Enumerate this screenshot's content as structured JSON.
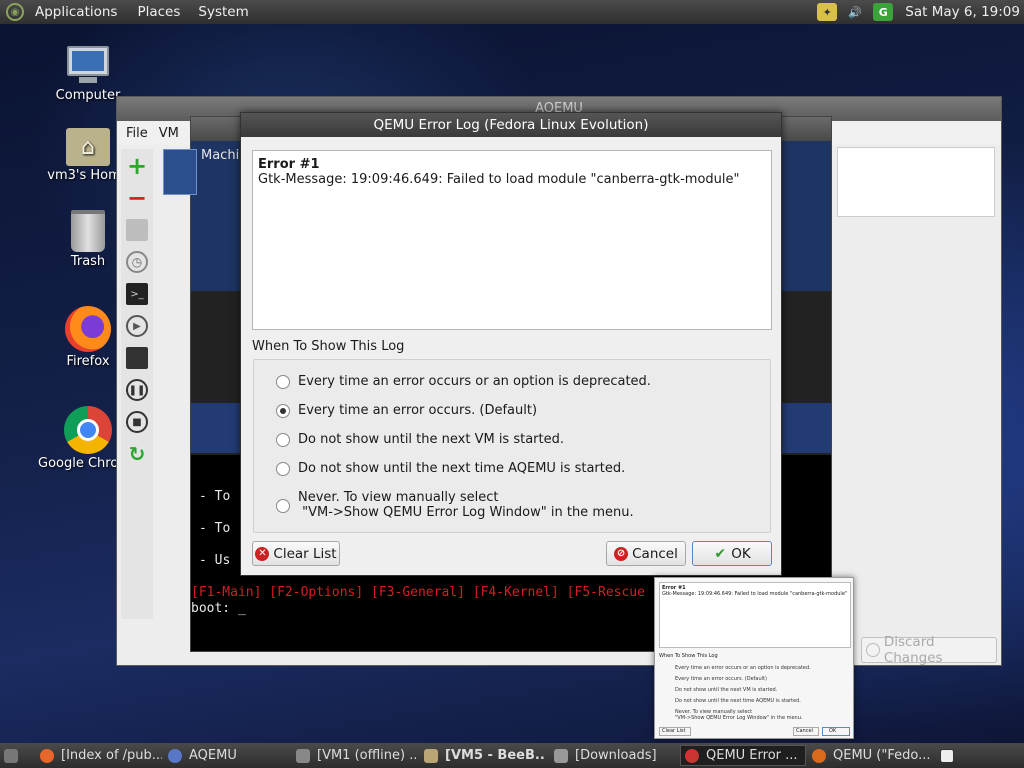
{
  "top_panel": {
    "menus": [
      "Applications",
      "Places",
      "System"
    ],
    "clock": "Sat May  6, 19:09"
  },
  "desktop_icons": [
    {
      "label": "Computer",
      "icon": "computer-icon"
    },
    {
      "label": "vm3's Home",
      "icon": "home-folder-icon"
    },
    {
      "label": "Trash",
      "icon": "trash-icon"
    },
    {
      "label": "Firefox",
      "icon": "firefox-icon"
    },
    {
      "label": "Google Chrome",
      "icon": "chrome-icon"
    }
  ],
  "aqemu_window": {
    "title": "AQEMU",
    "menu": [
      "File",
      "VM"
    ],
    "discard_label": "Discard Changes"
  },
  "vm_window": {
    "machine_label": "Machi",
    "console_lines": [
      "-  To",
      "-  To",
      "-  Us"
    ],
    "fkeys": "[F1-Main] [F2-Options] [F3-General] [F4-Kernel] [F5-Rescue",
    "boot_prompt": "boot: _"
  },
  "dialog": {
    "title": "QEMU Error Log (Fedora Linux Evolution)",
    "log_heading": "Error #1",
    "log_text": "Gtk-Message: 19:09:46.649: Failed to load module \"canberra-gtk-module\"",
    "group_label": "When To Show This Log",
    "options": [
      {
        "label": "Every time an error occurs or an option is deprecated.",
        "selected": false
      },
      {
        "label": "Every time an error occurs. (Default)",
        "selected": true
      },
      {
        "label": "Do not show until the next VM is started.",
        "selected": false
      },
      {
        "label": "Do not show until the next time AQEMU is started.",
        "selected": false
      },
      {
        "label": "Never. To view manually select",
        "label2": " \"VM->Show QEMU Error Log Window\" in the menu.",
        "selected": false
      }
    ],
    "clear_label": "Clear List",
    "cancel_label": "Cancel",
    "ok_label": "OK"
  },
  "thumbnail": {
    "heading": "Error #1",
    "text": "Gtk-Message: 19:09:46.649: Failed to load module \"canberra-gtk-module\"",
    "group": "When To Show This Log",
    "lines": [
      "Every time an error occurs or an option is deprecated.",
      "Every time an error occurs. (Default)",
      "Do not show until the next VM is started.",
      "Do not show until the next time AQEMU is started.",
      "Never. To view manually select",
      "\"VM->Show QEMU Error Log Window\" in the menu."
    ],
    "clear": "Clear List",
    "cancel": "Cancel",
    "ok": "OK"
  },
  "taskbar": {
    "items": [
      {
        "label": "[Index of /pub...",
        "icon": "firefox-icon"
      },
      {
        "label": "AQEMU",
        "icon": "aqemu-icon"
      },
      {
        "label": "[VM1 (offline) ...",
        "icon": "vm-icon"
      },
      {
        "label": "[VM5 - BeeB...",
        "icon": "folder-icon"
      },
      {
        "label": "[Downloads]",
        "icon": "folder-icon"
      },
      {
        "label": "QEMU Error ...",
        "icon": "qemu-icon"
      },
      {
        "label": "QEMU (\"Fedo...",
        "icon": "qemu-icon"
      }
    ]
  },
  "colors": {
    "desktop": "#132048",
    "panel": "#3a3a3a",
    "console_red": "#d22020",
    "ok_accent": "#2e9a2e",
    "cancel_red": "#cc2222"
  }
}
